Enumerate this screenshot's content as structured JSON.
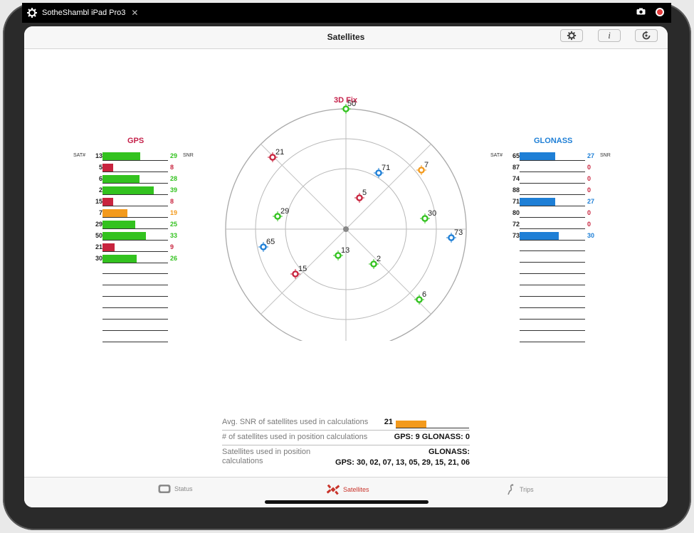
{
  "window": {
    "title": "SotheShambl iPad Pro3",
    "close_glyph": "✕",
    "icons": [
      "gear-icon",
      "camera-icon",
      "record-icon"
    ]
  },
  "navbar": {
    "title": "Satellites",
    "buttons": [
      {
        "name": "settings-button",
        "icon": "gear-icon"
      },
      {
        "name": "info-button",
        "icon": "info-icon",
        "label": "i"
      },
      {
        "name": "refresh-button",
        "icon": "refresh-icon"
      }
    ]
  },
  "colors": {
    "good": "#33c21f",
    "medium": "#f39a1d",
    "weak": "#c8243e",
    "glonass": "#1e7fd6",
    "gps_title": "#c5214a",
    "fix_title": "#c5214a"
  },
  "gps": {
    "title": "GPS",
    "sat_label": "SAT#",
    "snr_label": "SNR",
    "rows": [
      {
        "sat": "13",
        "snr": 29,
        "quality": "good"
      },
      {
        "sat": "5",
        "snr": 8,
        "quality": "weak"
      },
      {
        "sat": "6",
        "snr": 28,
        "quality": "good"
      },
      {
        "sat": "2",
        "snr": 39,
        "quality": "good"
      },
      {
        "sat": "15",
        "snr": 8,
        "quality": "weak"
      },
      {
        "sat": "7",
        "snr": 19,
        "quality": "medium"
      },
      {
        "sat": "29",
        "snr": 25,
        "quality": "good"
      },
      {
        "sat": "50",
        "snr": 33,
        "quality": "good"
      },
      {
        "sat": "21",
        "snr": 9,
        "quality": "weak"
      },
      {
        "sat": "30",
        "snr": 26,
        "quality": "good"
      }
    ],
    "empty_rows": 7
  },
  "glonass": {
    "title": "GLONASS",
    "sat_label": "SAT#",
    "snr_label": "SNR",
    "rows": [
      {
        "sat": "65",
        "snr": 27
      },
      {
        "sat": "87",
        "snr": 0
      },
      {
        "sat": "74",
        "snr": 0
      },
      {
        "sat": "88",
        "snr": 0
      },
      {
        "sat": "71",
        "snr": 27
      },
      {
        "sat": "80",
        "snr": 0
      },
      {
        "sat": "72",
        "snr": 0
      },
      {
        "sat": "73",
        "snr": 30
      }
    ],
    "empty_rows": 9
  },
  "skyplot": {
    "fix_label": "3D Fix",
    "satellites": [
      {
        "id": "50",
        "quality": "good"
      },
      {
        "id": "21",
        "quality": "weak"
      },
      {
        "id": "71",
        "quality": "glonass"
      },
      {
        "id": "7",
        "quality": "medium"
      },
      {
        "id": "5",
        "quality": "weak"
      },
      {
        "id": "29",
        "quality": "good"
      },
      {
        "id": "30",
        "quality": "good"
      },
      {
        "id": "73",
        "quality": "glonass"
      },
      {
        "id": "65",
        "quality": "glonass"
      },
      {
        "id": "13",
        "quality": "good"
      },
      {
        "id": "2",
        "quality": "good"
      },
      {
        "id": "15",
        "quality": "weak"
      },
      {
        "id": "6",
        "quality": "good"
      }
    ]
  },
  "stats": {
    "avg_snr_label": "Avg. SNR of satellites used in calculations",
    "avg_snr_value": "21",
    "avg_snr_fraction": 0.42,
    "used_count_label": "# of satellites used in position calculations",
    "used_count_value": "GPS: 9 GLONASS: 0",
    "used_list_label": "Satellites used in position calculations",
    "used_list_glonass": "GLONASS:",
    "used_list_gps": "GPS: 30, 02, 07, 13, 05, 29, 15, 21, 06"
  },
  "tabbar": {
    "tabs": [
      {
        "label": "Status",
        "icon": "status-icon",
        "active": false
      },
      {
        "label": "Satellites",
        "icon": "satellite-icon",
        "active": true
      },
      {
        "label": "Trips",
        "icon": "trips-icon",
        "active": false
      }
    ]
  }
}
